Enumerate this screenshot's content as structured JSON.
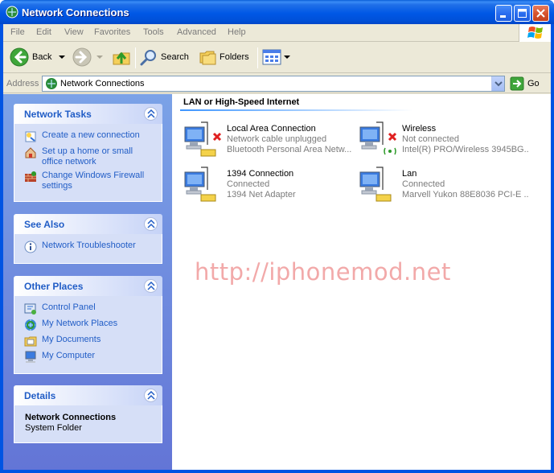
{
  "window": {
    "title": "Network Connections"
  },
  "menu": [
    "File",
    "Edit",
    "View",
    "Favorites",
    "Tools",
    "Advanced",
    "Help"
  ],
  "toolbar": {
    "back_label": "Back",
    "search_label": "Search",
    "folders_label": "Folders"
  },
  "address": {
    "label": "Address",
    "value": "Network Connections",
    "go_label": "Go"
  },
  "panels": {
    "network_tasks": {
      "title": "Network Tasks",
      "items": [
        {
          "label": "Create a new connection",
          "icon": "new-connection-icon"
        },
        {
          "label": "Set up a home or small office network",
          "icon": "home-network-icon"
        },
        {
          "label": "Change Windows Firewall settings",
          "icon": "firewall-icon"
        }
      ]
    },
    "see_also": {
      "title": "See Also",
      "items": [
        {
          "label": "Network Troubleshooter",
          "icon": "help-icon"
        }
      ]
    },
    "other_places": {
      "title": "Other Places",
      "items": [
        {
          "label": "Control Panel",
          "icon": "control-panel-icon"
        },
        {
          "label": "My Network Places",
          "icon": "network-places-icon"
        },
        {
          "label": "My Documents",
          "icon": "documents-icon"
        },
        {
          "label": "My Computer",
          "icon": "computer-icon"
        }
      ]
    },
    "details": {
      "title": "Details",
      "name": "Network Connections",
      "type": "System Folder"
    }
  },
  "group": {
    "title": "LAN or High-Speed Internet"
  },
  "connections": [
    {
      "name": "Local Area Connection",
      "status": "Network cable unplugged",
      "device": "Bluetooth Personal Area Netw...",
      "state": "error"
    },
    {
      "name": "Wireless",
      "status": "Not connected",
      "device": "Intel(R) PRO/Wireless 3945BG...",
      "state": "error-wireless"
    },
    {
      "name": "1394 Connection",
      "status": "Connected",
      "device": "1394 Net Adapter",
      "state": "ok"
    },
    {
      "name": "Lan",
      "status": "Connected",
      "device": "Marvell Yukon 88E8036 PCI-E ...",
      "state": "ok"
    }
  ],
  "watermark": "http://iphonemod.net",
  "colors": {
    "title_bar": "#0058e6",
    "task_link": "#215dc6",
    "left_pane": "#7ba2e7"
  }
}
